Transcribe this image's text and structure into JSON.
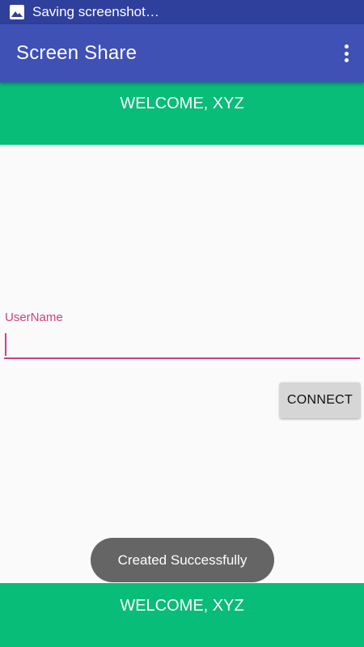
{
  "status_bar": {
    "notification_icon": "image-icon",
    "text": "Saving screenshot…"
  },
  "app_bar": {
    "title": "Screen Share",
    "menu_icon": "more-vert-icon"
  },
  "welcome_top": "WELCOME, XYZ",
  "form": {
    "username_label": "UserName",
    "username_value": "",
    "connect_label": "CONNECT"
  },
  "toast": "Created Successfully",
  "welcome_bottom": "WELCOME, XYZ",
  "colors": {
    "status_bar": "#2f3f9c",
    "app_bar": "#3f51b5",
    "banner": "#08bd77",
    "accent": "#d0407f",
    "button": "#d6d6d6",
    "toast": "#656565"
  }
}
